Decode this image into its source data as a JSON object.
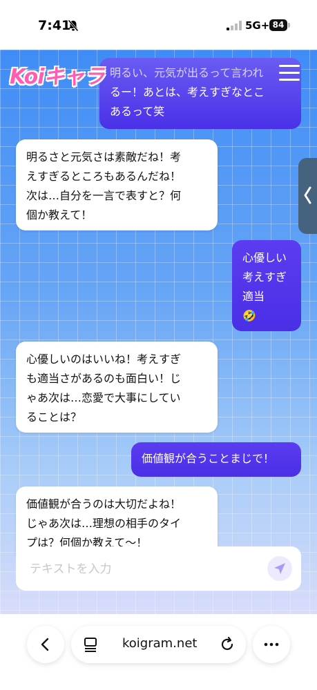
{
  "status": {
    "time": "7:41",
    "network": "5G+",
    "battery": "84"
  },
  "app": {
    "logo": "Koiキャラ"
  },
  "messages": [
    {
      "role": "user",
      "lines": [
        "明るい、元気が出るって言われ",
        "るー！あとは、考えすぎなとこ",
        "あるって笑"
      ]
    },
    {
      "role": "bot",
      "lines": [
        "明るさと元気さは素敵だね！考",
        "えすぎるところもあるんだね！",
        "次は…自分を一言で表すと？何",
        "個か教えて！"
      ]
    },
    {
      "role": "user",
      "lines": [
        "心優しい",
        "考えすぎ",
        "適当",
        "🤣"
      ]
    },
    {
      "role": "bot",
      "lines": [
        "心優しいのはいいね！考えすぎ",
        "も適当さがあるのも面白い！じ",
        "ゃあ次は…恋愛で大事にしてい",
        "ることは？"
      ]
    },
    {
      "role": "user",
      "lines": [
        "価値観が合うことまじで！"
      ]
    },
    {
      "role": "bot",
      "lines": [
        "価値観が合うのは大切だよね！",
        "じゃあ次は…理想の相手のタイ",
        "プは？何個か教えて〜！"
      ]
    }
  ],
  "input": {
    "placeholder": "テキストを入力",
    "value": ""
  },
  "browser": {
    "url": "koigram.net"
  },
  "colors": {
    "user_bubble": "#5333ec",
    "chat_bg": "#5b9af5",
    "logo": "#ff5db1"
  }
}
